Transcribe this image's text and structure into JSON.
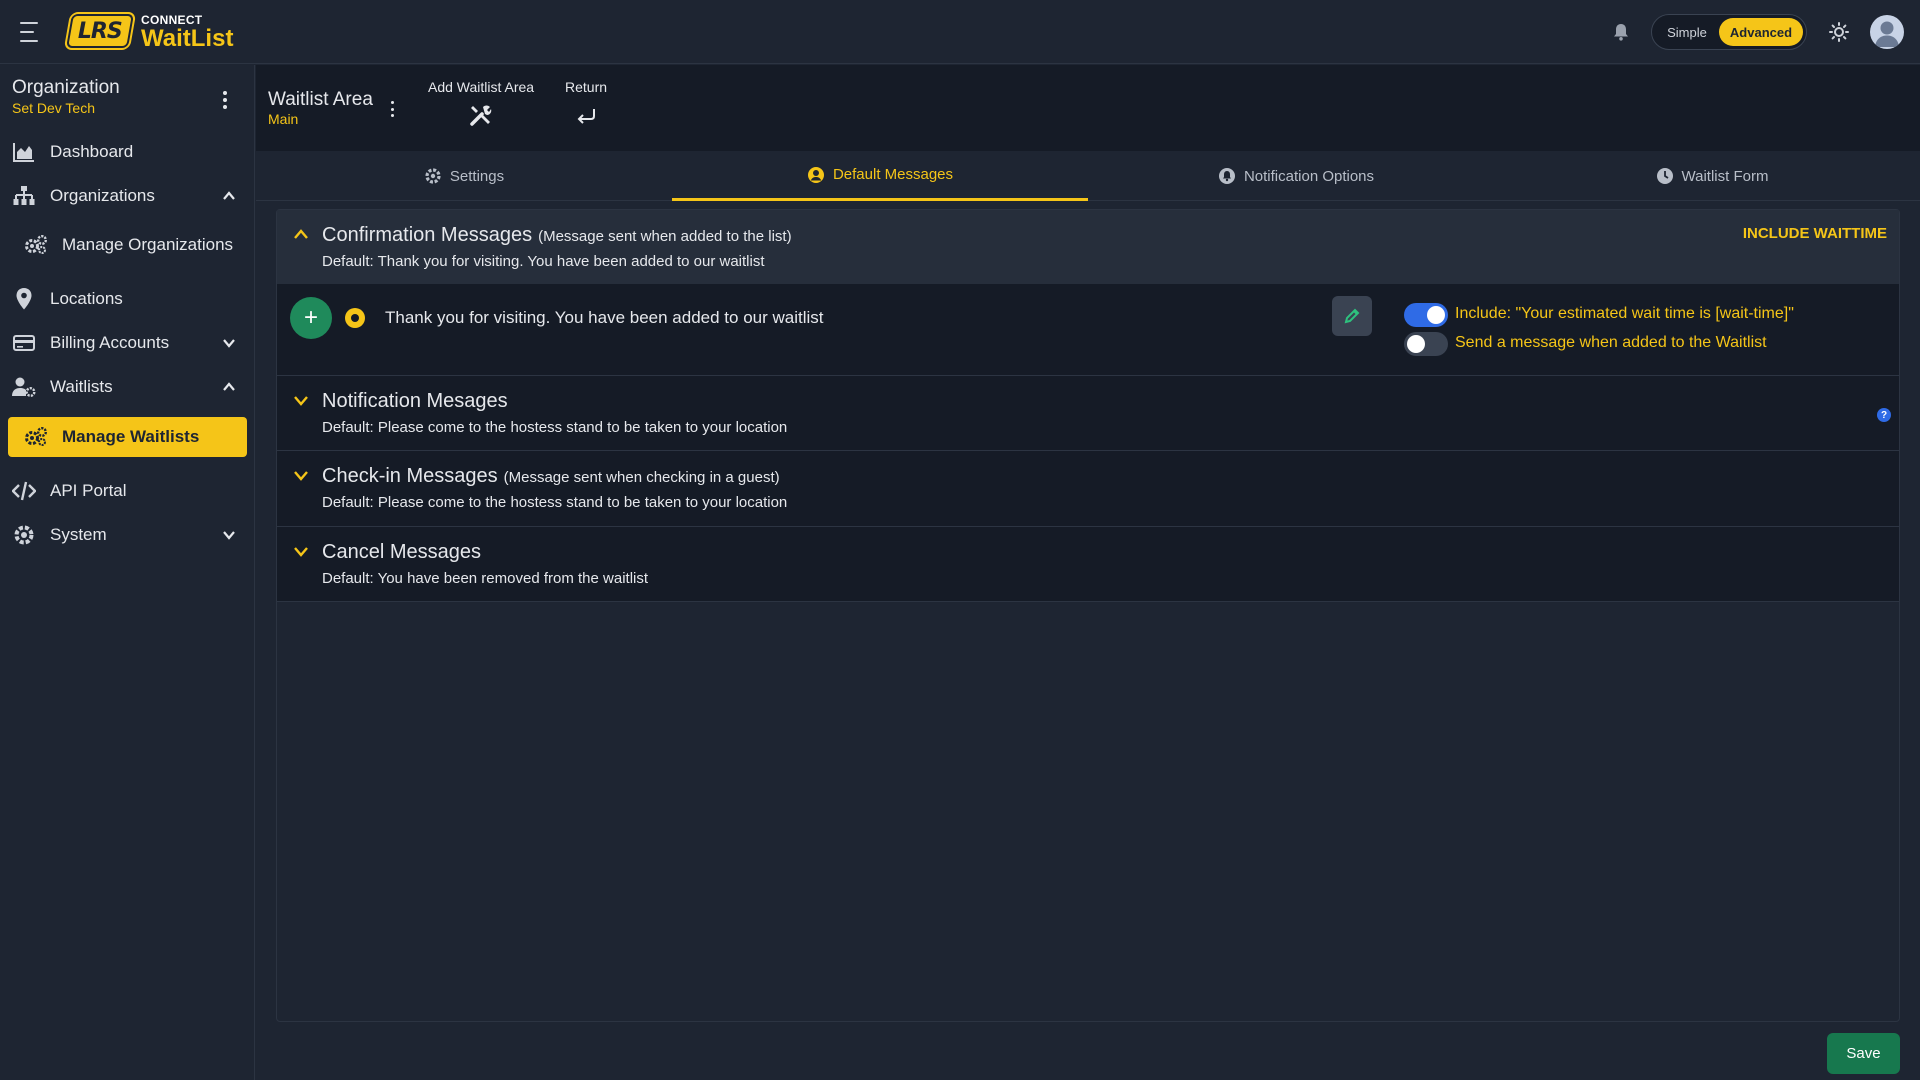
{
  "app": {
    "logo_text": "LRS",
    "brand_top": "CONNECT",
    "brand_name": "WaitList"
  },
  "topbar": {
    "mode_simple": "Simple",
    "mode_advanced": "Advanced",
    "mode_selected": "Advanced",
    "icons": [
      "menu-icon",
      "bell-icon",
      "sun-icon",
      "user-avatar-icon"
    ]
  },
  "sidebar": {
    "org_title": "Organization",
    "org_name": "Set Dev Tech",
    "items": [
      {
        "label": "Dashboard",
        "icon": "chart-area-icon"
      },
      {
        "label": "Organizations",
        "icon": "sitemap-icon",
        "expanded": true
      },
      {
        "label": "Manage Organizations",
        "icon": "gears-icon",
        "sub": true
      },
      {
        "label": "Locations",
        "icon": "location-pin-icon"
      },
      {
        "label": "Billing Accounts",
        "icon": "credit-card-icon",
        "expanded": false
      },
      {
        "label": "Waitlists",
        "icon": "users-gear-icon",
        "expanded": true
      },
      {
        "label": "Manage Waitlists",
        "icon": "gears-icon",
        "sub": true,
        "active": true
      },
      {
        "label": "API Portal",
        "icon": "code-icon"
      },
      {
        "label": "System",
        "icon": "gear-icon",
        "expanded": false
      }
    ]
  },
  "header": {
    "title": "Waitlist Area",
    "subtitle": "Main",
    "add_label": "Add Waitlist Area",
    "return_label": "Return"
  },
  "tabs": [
    {
      "label": "Settings",
      "icon": "gear-icon"
    },
    {
      "label": "Default Messages",
      "icon": "user-circle-icon",
      "active": true
    },
    {
      "label": "Notification Options",
      "icon": "bell-circle-icon"
    },
    {
      "label": "Waitlist Form",
      "icon": "clock-icon"
    }
  ],
  "sections": {
    "confirmation": {
      "title": "Confirmation Messages",
      "note": "(Message sent when added to the list)",
      "default": "Default: Thank you for visiting. You have been added to our waitlist",
      "include_waittime": "INCLUDE WAITTIME",
      "message": "Thank you for visiting. You have been added to our waitlist",
      "switch_include_label": "Include: \"Your estimated wait time is [wait-time]\"",
      "switch_include_on": true,
      "switch_send_label": "Send a message when added to the Waitlist",
      "switch_send_on": false
    },
    "notification": {
      "title": "Notification Mesages",
      "default": "Default: Please come to the hostess stand to be taken to your location",
      "help": "?"
    },
    "checkin": {
      "title": "Check-in Messages",
      "note": "(Message sent when checking in a guest)",
      "default": "Default: Please come to the hostess stand to be taken to your location"
    },
    "cancel": {
      "title": "Cancel Messages",
      "default": "Default: You have been removed from the waitlist"
    }
  },
  "footer": {
    "save_label": "Save"
  },
  "colors": {
    "accent": "#f5c518",
    "background": "#1e2532",
    "panel_dark": "#151b26",
    "save_green": "#17784e",
    "toggle_blue": "#2f6be6"
  }
}
